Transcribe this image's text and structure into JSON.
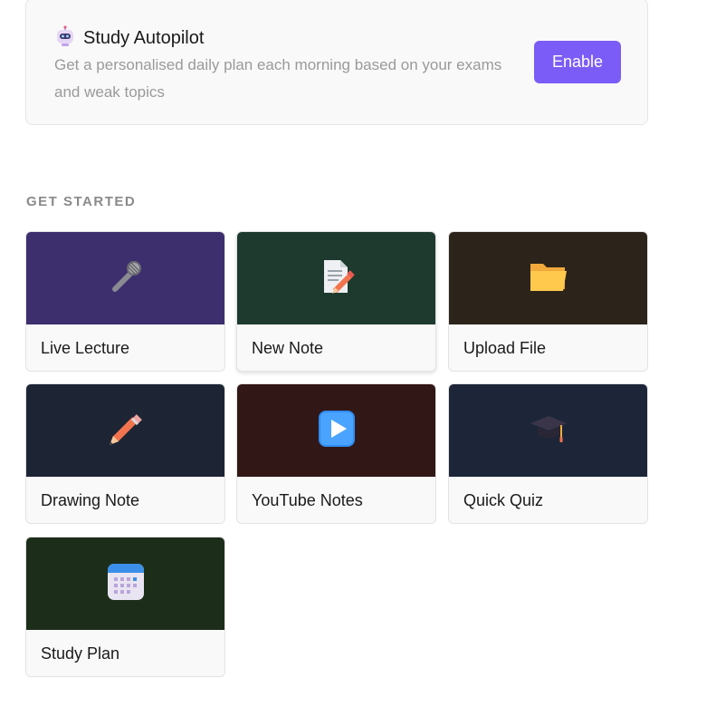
{
  "autopilot": {
    "title": "Study Autopilot",
    "description": "Get a personalised daily plan each morning based on your exams and weak topics",
    "enable_label": "Enable",
    "icon": "robot-icon"
  },
  "get_started": {
    "heading": "GET STARTED",
    "cards": [
      {
        "label": "Live Lecture",
        "icon": "microphone-icon",
        "color": "#3d2f6e"
      },
      {
        "label": "New Note",
        "icon": "note-pencil-icon",
        "color": "#1e3a2e"
      },
      {
        "label": "Upload File",
        "icon": "folder-icon",
        "color": "#2c241a"
      },
      {
        "label": "Drawing Note",
        "icon": "pencil-icon",
        "color": "#1d2535"
      },
      {
        "label": "YouTube Notes",
        "icon": "play-button-icon",
        "color": "#321717"
      },
      {
        "label": "Quick Quiz",
        "icon": "graduation-cap-icon",
        "color": "#1d2638"
      },
      {
        "label": "Study Plan",
        "icon": "calendar-icon",
        "color": "#1c2e1a"
      }
    ]
  }
}
